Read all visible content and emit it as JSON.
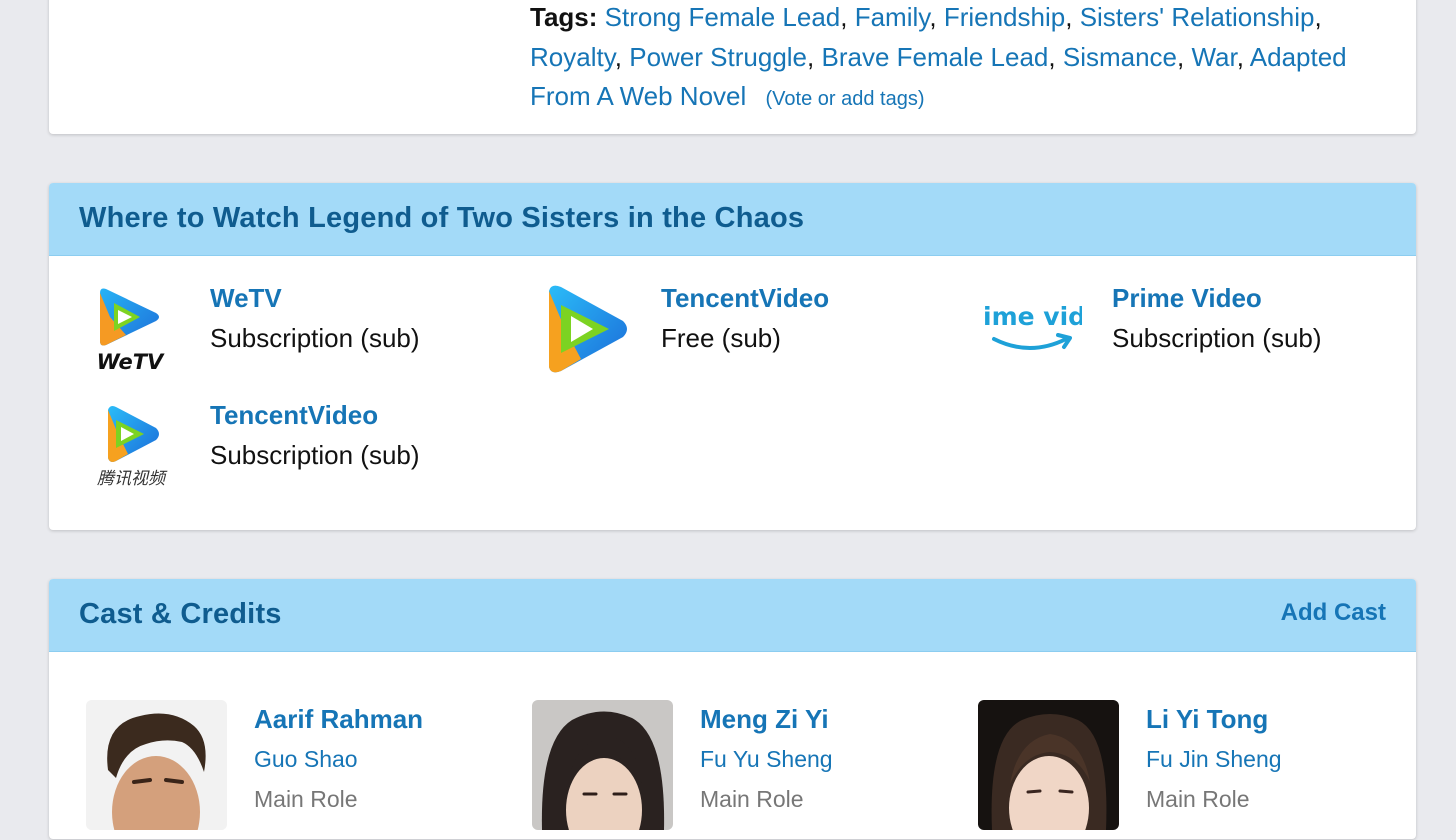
{
  "tags_section": {
    "label": "Tags:",
    "tags": [
      "Strong Female Lead",
      "Family",
      "Friendship",
      "Sisters' Relationship",
      "Royalty",
      "Power Struggle",
      "Brave Female Lead",
      "Sismance",
      "War",
      "Adapted From A Web Novel"
    ],
    "vote_link": "(Vote or add tags)"
  },
  "watch": {
    "title": "Where to Watch Legend of Two Sisters in the Chaos",
    "providers": [
      {
        "name": "WeTV",
        "type": "Subscription (sub)",
        "logo": "wetv-logo",
        "logo_text": "WeTV"
      },
      {
        "name": "TencentVideo",
        "type": "Free (sub)",
        "logo": "tencent-video-logo"
      },
      {
        "name": "Prime Video",
        "type": "Subscription (sub)",
        "logo": "prime-video-logo",
        "logo_text": "ime vide"
      },
      {
        "name": "TencentVideo",
        "type": "Subscription (sub)",
        "logo": "tencent-video-cn-logo",
        "logo_text": "腾讯视频"
      }
    ]
  },
  "cast": {
    "title": "Cast & Credits",
    "add_label": "Add Cast",
    "members": [
      {
        "name": "Aarif Rahman",
        "character": "Guo Shao",
        "role": "Main Role"
      },
      {
        "name": "Meng Zi Yi",
        "character": "Fu Yu Sheng",
        "role": "Main Role"
      },
      {
        "name": "Li Yi Tong",
        "character": "Fu Jin Sheng",
        "role": "Main Role"
      }
    ]
  },
  "colors": {
    "link": "#1675b6",
    "header_bg": "#a3daf8",
    "header_text": "#0f5c8f",
    "page_bg": "#e9eaee"
  }
}
